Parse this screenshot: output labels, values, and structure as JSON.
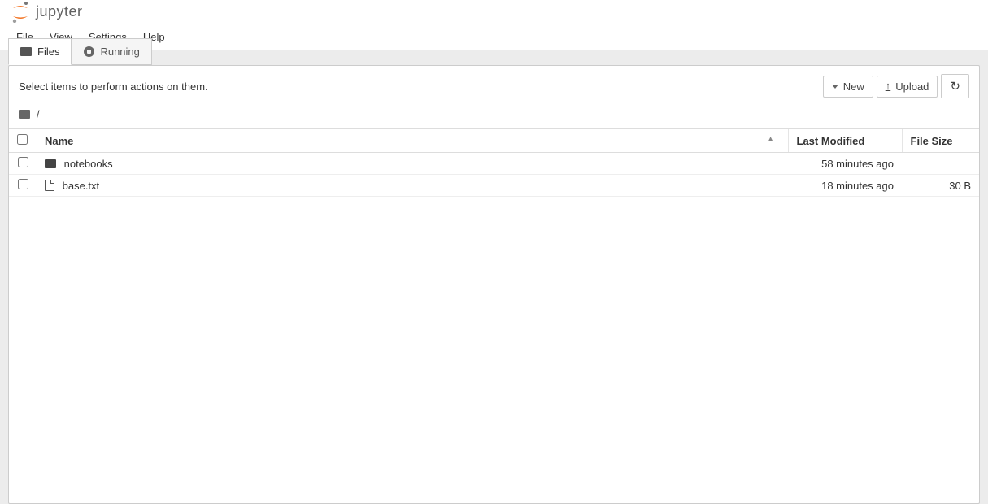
{
  "brand": {
    "name": "jupyter"
  },
  "menu": {
    "file": "File",
    "view": "View",
    "settings": "Settings",
    "help": "Help"
  },
  "tabs": {
    "files": "Files",
    "running": "Running"
  },
  "toolbar": {
    "hint": "Select items to perform actions on them.",
    "new_label": "New",
    "upload_label": "Upload"
  },
  "breadcrumb": {
    "root": "/"
  },
  "columns": {
    "name": "Name",
    "modified": "Last Modified",
    "size": "File Size"
  },
  "items": [
    {
      "name": "notebooks",
      "type": "folder",
      "modified": "58 minutes ago",
      "size": ""
    },
    {
      "name": "base.txt",
      "type": "file",
      "modified": "18 minutes ago",
      "size": "30 B"
    }
  ]
}
